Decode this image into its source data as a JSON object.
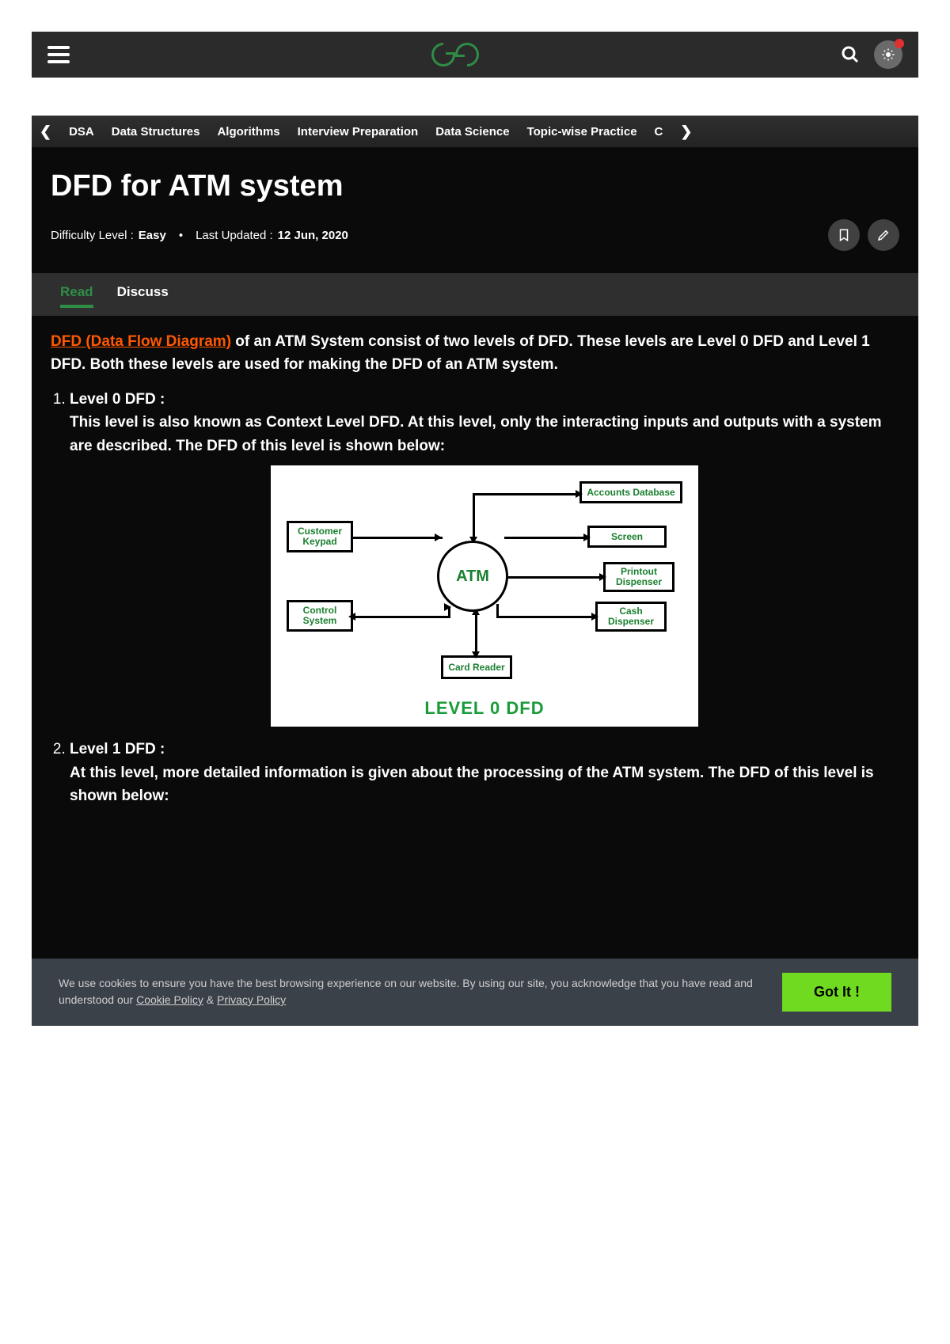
{
  "nav": {
    "items": [
      "DSA",
      "Data Structures",
      "Algorithms",
      "Interview Preparation",
      "Data Science",
      "Topic-wise Practice",
      "C"
    ]
  },
  "article": {
    "title": "DFD for ATM system",
    "difficulty_label": "Difficulty Level :",
    "difficulty_value": "Easy",
    "updated_label": "Last Updated :",
    "updated_value": "12 Jun, 2020"
  },
  "tabs": {
    "read": "Read",
    "discuss": "Discuss"
  },
  "intro": {
    "link_text": "DFD (Data Flow Diagram)",
    "rest": " of an ATM System consist of two levels of DFD. These levels are Level 0 DFD and Level 1 DFD. Both these levels are used for making the DFD of an ATM system."
  },
  "levels": [
    {
      "title": "Level 0 DFD :",
      "body": "This level is also known as Context Level DFD. At this level, only the interacting inputs and outputs with a system are described. The DFD of this level is shown below:"
    },
    {
      "title": "Level 1 DFD :",
      "body": "At this level, more detailed information is given about the processing of the ATM system. The DFD of this level is shown below:"
    }
  ],
  "diagram": {
    "center": "ATM",
    "boxes": {
      "customer_keypad": "Customer Keypad",
      "control_system": "Control System",
      "card_reader": "Card Reader",
      "accounts_db": "Accounts Database",
      "screen": "Screen",
      "printout_dispenser": "Printout Dispenser",
      "cash_dispenser": "Cash Dispenser"
    },
    "caption": "LEVEL 0 DFD"
  },
  "chart_data": {
    "type": "diagram",
    "title": "LEVEL 0 DFD",
    "center_process": "ATM",
    "external_entities": [
      "Customer Keypad",
      "Control System",
      "Card Reader",
      "Accounts Database",
      "Screen",
      "Printout Dispenser",
      "Cash Dispenser"
    ],
    "flows": [
      {
        "from": "Customer Keypad",
        "to": "ATM",
        "direction": "one-way"
      },
      {
        "from": "ATM",
        "to": "Control System",
        "direction": "two-way"
      },
      {
        "from": "ATM",
        "to": "Card Reader",
        "direction": "two-way"
      },
      {
        "from": "ATM",
        "to": "Accounts Database",
        "direction": "two-way"
      },
      {
        "from": "ATM",
        "to": "Screen",
        "direction": "one-way"
      },
      {
        "from": "ATM",
        "to": "Printout Dispenser",
        "direction": "one-way"
      },
      {
        "from": "ATM",
        "to": "Cash Dispenser",
        "direction": "one-way"
      }
    ]
  },
  "cookies": {
    "text_prefix": "We use cookies to ensure you have the best browsing experience on our website. By using our site, you acknowledge that you have read and understood our ",
    "cookie_policy": "Cookie Policy",
    "amp": " & ",
    "privacy_policy": "Privacy Policy",
    "button": "Got It !"
  }
}
